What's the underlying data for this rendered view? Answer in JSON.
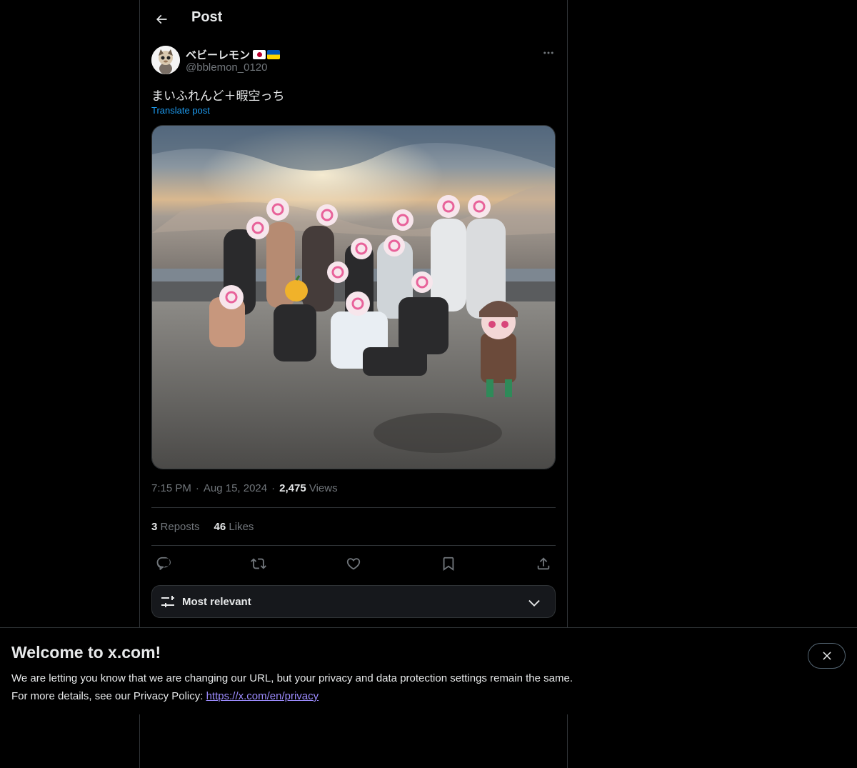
{
  "header": {
    "title": "Post"
  },
  "post": {
    "author": {
      "display_name": "ベビーレモン",
      "handle": "@bblemon_0120",
      "flags": [
        "japan-flag-icon",
        "ukraine-flag-icon"
      ]
    },
    "text": "まいふれんど＋暇空っち",
    "translate_label": "Translate post",
    "time": "7:15 PM",
    "date": "Aug 15, 2024",
    "views_count": "2,475",
    "views_label": "Views",
    "separator": "·",
    "reposts_count": "3",
    "reposts_label": "Reposts",
    "likes_count": "46",
    "likes_label": "Likes"
  },
  "actions": [
    "reply-icon",
    "repost-icon",
    "like-icon",
    "bookmark-icon",
    "share-icon"
  ],
  "sort": {
    "label": "Most relevant"
  },
  "welcome": {
    "title": "Welcome to x.com!",
    "line1": "We are letting you know that we are changing our URL, but your privacy and data protection settings remain the same.",
    "line2_prefix": "For more details, see our Privacy Policy: ",
    "link": "https://x.com/en/privacy"
  },
  "colors": {
    "accent": "#1d9bf0",
    "link": "#9d8cff",
    "muted": "#71767b",
    "text": "#e7e9ea",
    "border": "#2f3336"
  }
}
